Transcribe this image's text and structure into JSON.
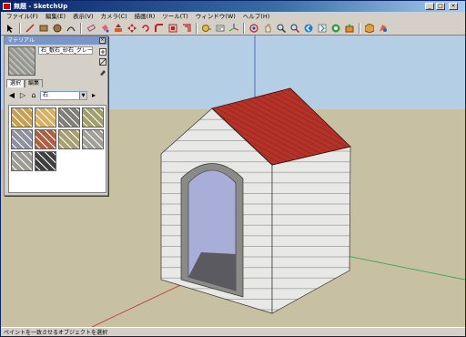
{
  "window": {
    "title": "無題 - SketchUp",
    "minimize": "_",
    "maximize": "□",
    "close": "×"
  },
  "menu": {
    "items": [
      "ファイル(F)",
      "編集(E)",
      "表示(V)",
      "カメラ(C)",
      "描画(R)",
      "ツール(T)",
      "ウィンドウ(W)",
      "ヘルプ(H)"
    ]
  },
  "toolbar": {
    "tools": [
      "select-icon",
      "line-icon",
      "rectangle-icon",
      "circle-icon",
      "arc-icon",
      "eraser-icon",
      "paint-bucket-icon",
      "push-pull-icon",
      "move-icon",
      "rotate-icon",
      "follow-me-icon",
      "scale-icon",
      "offset-icon",
      "tape-measure-icon",
      "text-icon",
      "axes-icon",
      "orbit-icon",
      "pan-icon",
      "zoom-icon",
      "zoom-extents-icon",
      "previous-view-icon",
      "next-view-icon",
      "get-models-icon",
      "share-model-icon",
      "components-icon",
      "materials-icon"
    ]
  },
  "materials_panel": {
    "title": "マテリアル",
    "close": "×",
    "material_name": "石_敷石_砂石_グレー",
    "tabs": [
      "選択",
      "編集"
    ],
    "category": "石",
    "swatch_colors": [
      "#c8a050",
      "#d8b060",
      "#808078",
      "#a0a068",
      "#9090a0",
      "#b06040",
      "#a8a070",
      "#a0a098",
      "#9c9c94",
      "#404040"
    ]
  },
  "status": {
    "text": "ペイントを一致させるオブジェクトを選択"
  },
  "scene": {
    "sky_color": "#b4cee6",
    "ground_color": "#c8c0a2",
    "roof_color": "#b43228",
    "wall_color": "#e6e6e4"
  }
}
